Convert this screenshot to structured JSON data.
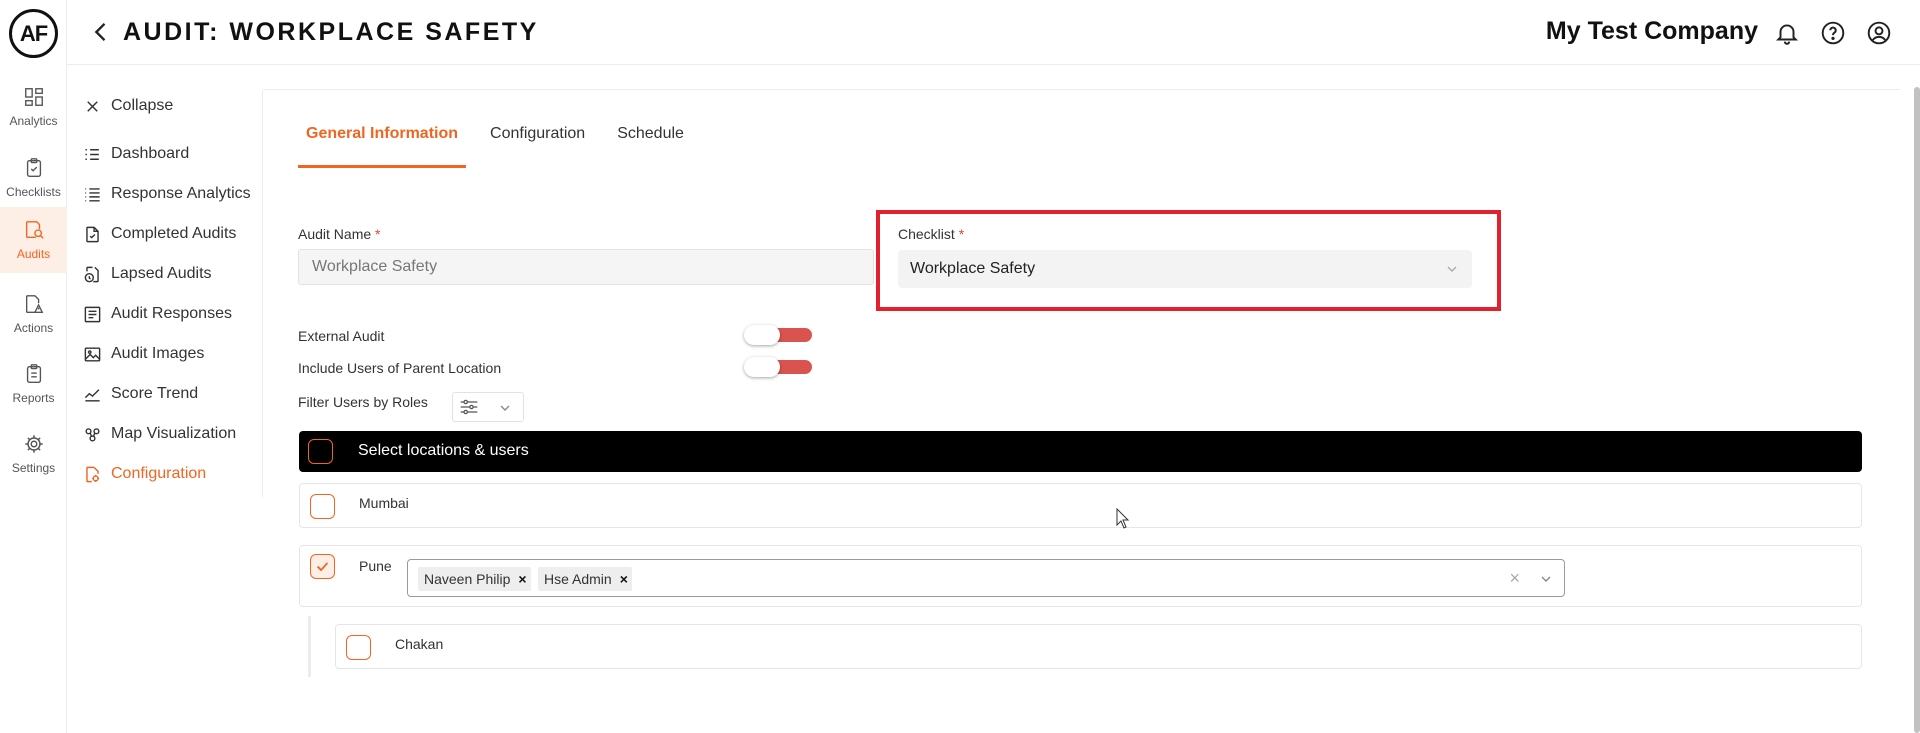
{
  "app": {
    "logo_text": "AF",
    "page_title": "AUDIT: WORKPLACE SAFETY",
    "company": "My Test Company"
  },
  "rail": {
    "items": [
      {
        "label": "Analytics",
        "icon": "analytics-icon"
      },
      {
        "label": "Checklists",
        "icon": "checklist-icon"
      },
      {
        "label": "Audits",
        "icon": "audit-icon",
        "active": true
      },
      {
        "label": "Actions",
        "icon": "actions-icon"
      },
      {
        "label": "Reports",
        "icon": "reports-icon"
      },
      {
        "label": "Settings",
        "icon": "gear-icon"
      }
    ]
  },
  "subnav": {
    "collapse_label": "Collapse",
    "items": [
      {
        "label": "Dashboard"
      },
      {
        "label": "Response Analytics"
      },
      {
        "label": "Completed Audits"
      },
      {
        "label": "Lapsed Audits"
      },
      {
        "label": "Audit Responses"
      },
      {
        "label": "Audit Images"
      },
      {
        "label": "Score Trend"
      },
      {
        "label": "Map Visualization"
      },
      {
        "label": "Configuration",
        "active": true
      }
    ]
  },
  "tabs": [
    {
      "label": "General Information",
      "active": true
    },
    {
      "label": "Configuration"
    },
    {
      "label": "Schedule"
    }
  ],
  "form": {
    "audit_name_label": "Audit Name",
    "required_mark": "*",
    "audit_name_value": "Workplace Safety",
    "checklist_label": "Checklist",
    "checklist_value": "Workplace Safety",
    "external_audit_label": "External Audit",
    "include_parent_label": "Include Users of Parent Location",
    "filter_roles_label": "Filter Users by Roles"
  },
  "locations": {
    "header_label": "Select locations & users",
    "items": [
      {
        "name": "Mumbai",
        "checked": false
      },
      {
        "name": "Pune",
        "checked": true,
        "users": [
          "Naveen Philip",
          "Hse Admin"
        ]
      },
      {
        "name": "Chakan",
        "checked": false
      }
    ],
    "chip_remove": "×",
    "clear_glyph": "×"
  },
  "colors": {
    "accent": "#f06522",
    "highlight_border": "#e3202e",
    "toggle_track": "#d9534f"
  }
}
